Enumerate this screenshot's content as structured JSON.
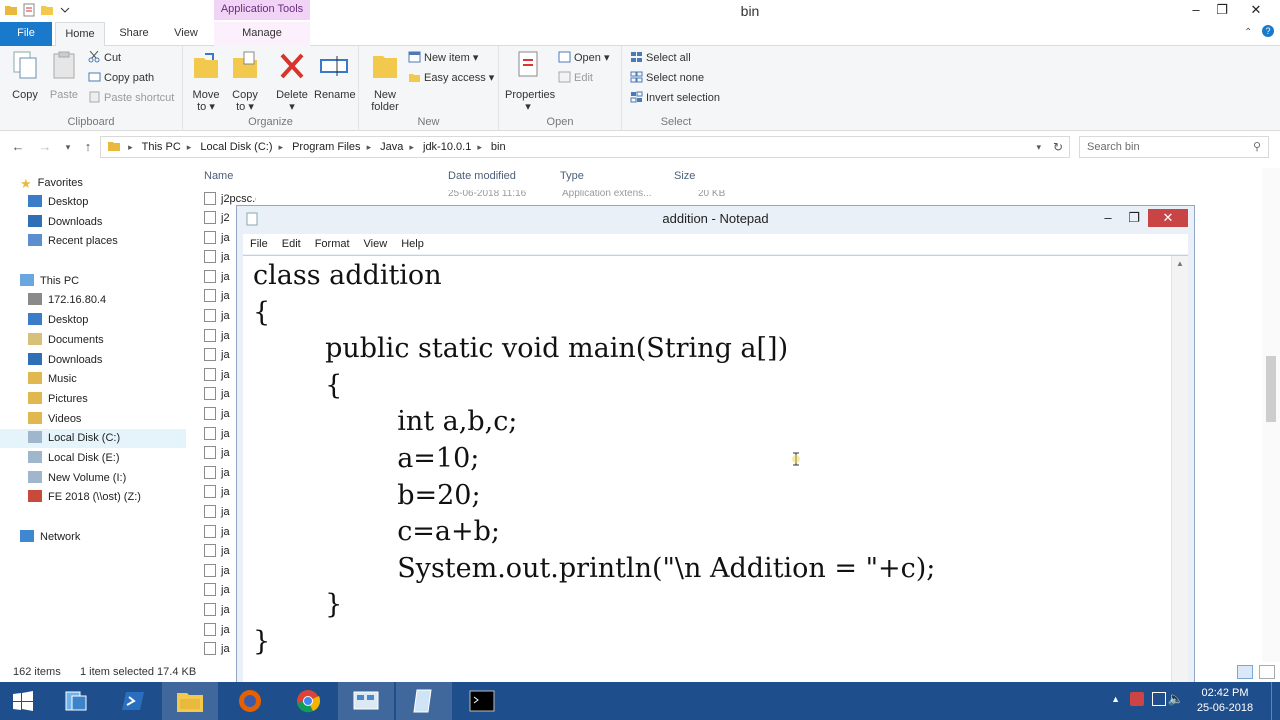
{
  "explorer": {
    "title": "bin",
    "app_tools_label": "Application Tools",
    "tabs": {
      "file": "File",
      "home": "Home",
      "share": "Share",
      "view": "View",
      "manage": "Manage"
    },
    "ribbon": {
      "clipboard": {
        "group": "Clipboard",
        "copy": "Copy",
        "paste": "Paste",
        "cut": "Cut",
        "copy_path": "Copy path",
        "paste_shortcut": "Paste shortcut"
      },
      "organize": {
        "group": "Organize",
        "move_to_1": "Move",
        "move_to_2": "to",
        "copy_to_1": "Copy",
        "copy_to_2": "to",
        "delete": "Delete",
        "rename": "Rename"
      },
      "new": {
        "group": "New",
        "new_folder_1": "New",
        "new_folder_2": "folder",
        "new_item": "New item",
        "easy_access": "Easy access"
      },
      "open": {
        "group": "Open",
        "properties": "Properties",
        "open": "Open",
        "edit": "Edit"
      },
      "select": {
        "group": "Select",
        "select_all": "Select all",
        "select_none": "Select none",
        "invert_selection": "Invert selection"
      }
    },
    "address": [
      "This PC",
      "Local Disk (C:)",
      "Program Files",
      "Java",
      "jdk-10.0.1",
      "bin"
    ],
    "search_placeholder": "Search bin",
    "nav": {
      "favorites": "Favorites",
      "favorites_items": [
        "Desktop",
        "Downloads",
        "Recent places"
      ],
      "this_pc": "This PC",
      "pc_items": [
        "172.16.80.4",
        "Desktop",
        "Documents",
        "Downloads",
        "Music",
        "Pictures",
        "Videos",
        "Local Disk (C:)",
        "Local Disk (E:)",
        "New Volume (I:)",
        "FE 2018 (\\\\ost) (Z:)"
      ],
      "network": "Network"
    },
    "columns": {
      "name": "Name",
      "date": "Date modified",
      "type": "Type",
      "size": "Size"
    },
    "first_file": {
      "name": "j2pcsc.dll",
      "date": "25-06-2018 11:16",
      "type": "Application extens...",
      "size": "20 KB"
    },
    "file_stubs": [
      "j2",
      "ja",
      "ja",
      "ja",
      "ja",
      "ja",
      "ja",
      "ja",
      "ja",
      "ja",
      "ja",
      "ja",
      "ja",
      "ja",
      "ja",
      "ja",
      "ja",
      "ja",
      "ja",
      "ja",
      "ja",
      "ja",
      "ja",
      "jc"
    ],
    "status": {
      "items": "162 items",
      "selected": "1 item selected  17.4 KB"
    }
  },
  "notepad": {
    "title": "addition - Notepad",
    "menu": [
      "File",
      "Edit",
      "Format",
      "View",
      "Help"
    ],
    "code_lines": [
      "class addition",
      "{",
      "\t\tpublic static void main(String a[])",
      "\t\t{",
      "\t\t\t\tint a,b,c;",
      "\t\t\t\ta=10;",
      "\t\t\t\tb=20;",
      "\t\t\t\tc=a+b;",
      "\t\t\t\tSystem.out.println(\"\\n Addition = \"+c);",
      "\t\t}",
      "}"
    ]
  },
  "taskbar": {
    "time": "02:42 PM",
    "date": "25-06-2018"
  },
  "colors": {
    "file_tab": "#1979ca",
    "taskbar": "#1f4e8c",
    "app_tools": "#f1d3f5",
    "close_button": "#c94545"
  }
}
